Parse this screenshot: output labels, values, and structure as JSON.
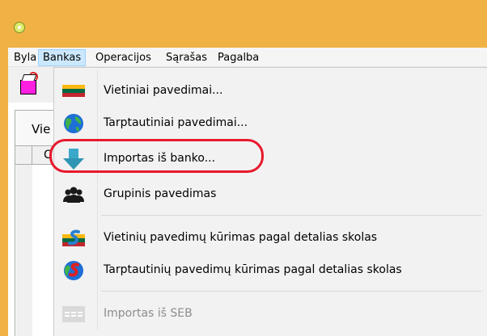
{
  "menubar": {
    "items": [
      {
        "label": "Byla"
      },
      {
        "label": "Bankas"
      },
      {
        "label": "Operacijos"
      },
      {
        "label": "Sąrašas"
      },
      {
        "label": "Pagalba"
      }
    ],
    "active_item": "Bankas"
  },
  "content": {
    "tab_label_partial": "Vie",
    "grid_header_partial": "C"
  },
  "bankas_menu": {
    "items": [
      {
        "label": "Vietiniai pavedimai...",
        "icon": "lithuania-flag-icon",
        "enabled": true
      },
      {
        "label": "Tarptautiniai pavedimai...",
        "icon": "globe-icon",
        "enabled": true
      },
      {
        "label": "Importas iš banko...",
        "icon": "download-arrow-icon",
        "enabled": true
      },
      {
        "label": "Grupinis pavedimas",
        "icon": "group-users-icon",
        "enabled": true
      },
      {
        "label": "Vietinių pavedimų kūrimas pagal detalias skolas",
        "icon": "flag-s-icon",
        "enabled": true
      },
      {
        "label": "Tarptautinių pavedimų kūrimas pagal detalias skolas",
        "icon": "globe-s-icon",
        "enabled": true
      },
      {
        "label": "Importas iš SEB",
        "icon": "seb-logo-icon",
        "enabled": false
      }
    ]
  },
  "colors": {
    "title_bar": "#f0b245",
    "menu_active_bg": "#cce8ff",
    "menu_active_border": "#99d1ff",
    "highlight_oval": "#e8182c",
    "disabled_text": "#8d8d8d"
  }
}
